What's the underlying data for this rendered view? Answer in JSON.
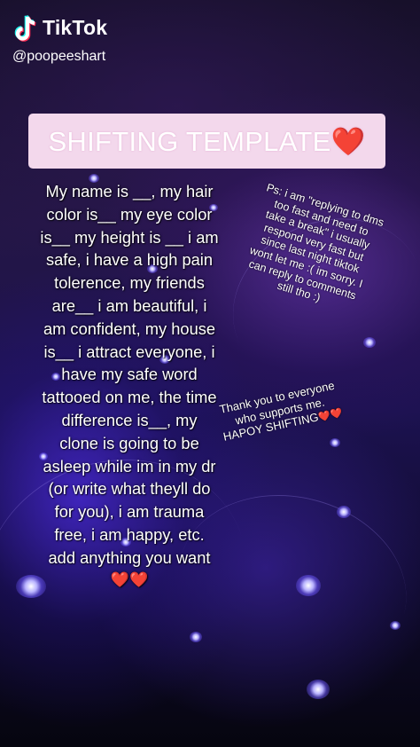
{
  "watermark": {
    "app_name": "TikTok",
    "handle": "@poopeeshart",
    "logo_icon": "tiktok-note-icon"
  },
  "banner": {
    "title": "SHIFTING TEMPLATE",
    "emoji": "❤️",
    "background": "#f3d8ec"
  },
  "template": {
    "lines": [
      "My name is __, my hair",
      "color is__ my eye color",
      "is__ my height is __ i am",
      "safe, i have a high pain",
      "tolerence, my friends",
      "are__ i am beautiful, i",
      "am confident, my house",
      "is__ i attract everyone, i",
      "have my safe word",
      "tattooed on me, the time",
      "difference is__, my",
      "clone is going to be",
      "asleep while im in my dr",
      "(or write what theyll do",
      "for you), i am trauma",
      "free, i am happy, etc.",
      "add anything you want"
    ],
    "hearts": "❤️❤️"
  },
  "note": {
    "lines": [
      "Ps: i am \"replying to dms",
      "too fast and need to",
      "take a break\" i usually",
      "respond very fast but",
      "since last night tiktok",
      "wont let me :( im sorry. I",
      "can reply to comments",
      "still tho :)"
    ]
  },
  "thanks": {
    "lines": [
      "Thank you to everyone",
      "who supports me.",
      "HAPOY SHIFTING"
    ],
    "hearts": "❤️❤️"
  },
  "colors": {
    "accent_heart": "#e8202a",
    "background_purple": "#241646",
    "light_glow": "#6a5aff"
  }
}
